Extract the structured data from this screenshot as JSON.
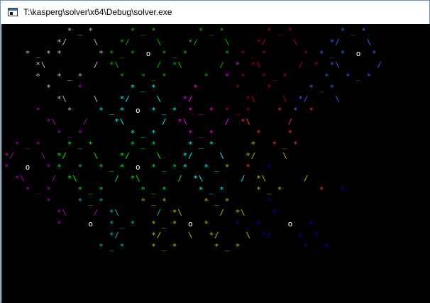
{
  "window": {
    "title": "T:\\kasperg\\solver\\x64\\Debug\\solver.exe",
    "icon": "console-app-icon"
  },
  "console": {
    "background": "#000000",
    "palette": {
      "w": "#c0c0c0",
      "g": "#00c000",
      "G": "#00ff00",
      "r": "#c00000",
      "R": "#ff3030",
      "b": "#0000e0",
      "B": "#3060ff",
      "m": "#c000c0",
      "M": "#ff00ff",
      "c": "#00c0c0",
      "C": "#00ffff",
      "y": "#c0c000",
      "W": "#ffffff"
    },
    "lines": [
      "            w _ w       g _ g        g _ g        r _ r         B _ B",
      "          w/     \\    g/     \\     g/     \\     r/     \\      B/     \\",
      "    w _ w w       w g _ g  o  g _ g       g  r _ r       r  B _ B  o  B",
      "      w\\         /  g\\       /  g\\       /  M  r\\       /  r  B\\       /",
      "      w   w _ w       g   g _ g       g   M  r   r _ r       B   B _ B",
      "        w     m         C _ C       M       r     r       B _ B",
      "          w\\     \\    C/     \\    M/          r\\     \\  B/     \\",
      "      m     w     C _ C  o  C _ C  M _ M  r _ r     R  B  R",
      "        m\\     /     C\\       /  M\\       /  R\\       /",
      "          m _ m         C _ C      M _ M        R     R",
      "  m _ m     G _ G       G _ G      C _ C       y   R _ R",
      "m/     \\  G/     \\    G/     \\    C/     \\    y/     \\",
      "m   o   m G   c   G _ G  o  G _ G C   C _ y   R   b",
      "  m\\     /  G\\       /  G\\       /  C\\       /  y\\       /",
      "    m _ m     G _ G       G _ G      C _ C      y _ y       R   b",
      "        m     c _ c       y _ y       y _ y       b",
      "          m\\     /  c\\       /  y\\       /  y\\     b",
      "          m     o   c _ c   y _ y  o  y     b _ b     o   b",
      "                    c/      y/     \\   y/     \\  b/     \\  b",
      "                  c _ c     y _ y       y _ y            b _ b"
    ]
  }
}
